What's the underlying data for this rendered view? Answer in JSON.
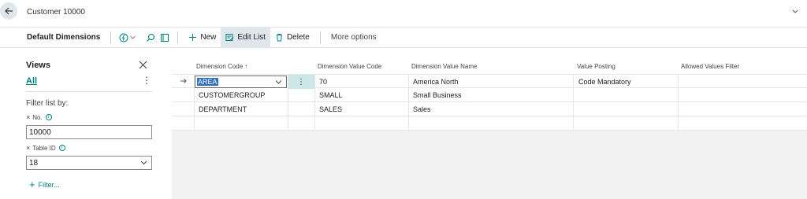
{
  "header": {
    "title": "Customer 10000"
  },
  "actionbar": {
    "page_name": "Default Dimensions",
    "new_label": "New",
    "edit_list_label": "Edit List",
    "delete_label": "Delete",
    "more_options_label": "More options"
  },
  "views": {
    "title": "Views",
    "all_label": "All",
    "filter_heading": "Filter list by:",
    "filters": [
      {
        "label": "No.",
        "value": "10000"
      },
      {
        "label": "Table ID",
        "value": "18"
      }
    ],
    "add_filter_label": "Filter..."
  },
  "grid": {
    "columns": [
      "Dimension Code ↑",
      "Dimension Value Code",
      "Dimension Value Name",
      "Value Posting",
      "Allowed Values Filter"
    ],
    "rows": [
      {
        "dimension_code": "AREA",
        "value_code": "70",
        "value_name": "America North",
        "value_posting": "Code Mandatory",
        "allowed_filter": ""
      },
      {
        "dimension_code": "CUSTOMERGROUP",
        "value_code": "SMALL",
        "value_name": "Small Business",
        "value_posting": "",
        "allowed_filter": ""
      },
      {
        "dimension_code": "DEPARTMENT",
        "value_code": "SALES",
        "value_name": "Sales",
        "value_posting": "",
        "allowed_filter": ""
      },
      {
        "dimension_code": "",
        "value_code": "",
        "value_name": "",
        "value_posting": "",
        "allowed_filter": ""
      }
    ],
    "row_actions_glyph": "⋮"
  },
  "colors": {
    "accent": "#00827f",
    "selection": "#2f6fbd",
    "active_button_bg": "#dfe7ec",
    "row_actions_bg": "#cde7e8"
  },
  "icons": [
    "back-arrow-icon",
    "chevron-down-icon",
    "bolt-icon",
    "search-icon",
    "filter-pane-icon",
    "plus-icon",
    "edit-list-icon",
    "delete-icon",
    "close-icon",
    "more-dots-icon",
    "info-icon",
    "row-arrow-icon"
  ]
}
